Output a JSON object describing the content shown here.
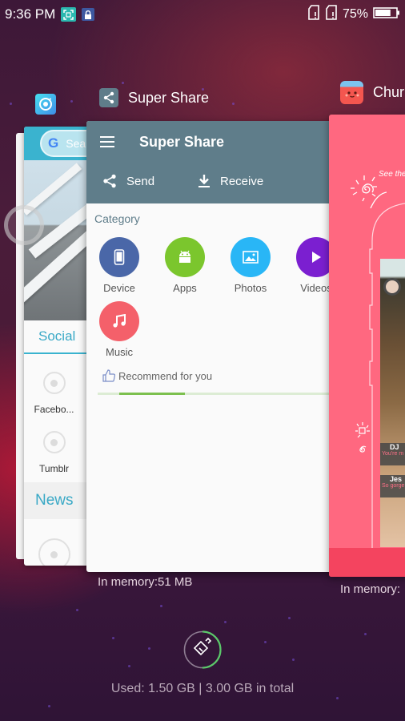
{
  "status_bar": {
    "time": "9:36 PM",
    "left_icons": [
      "screenshot-icon",
      "lock-icon"
    ],
    "right_icons": [
      "sim-1-no-signal-icon",
      "sim-2-no-signal-icon"
    ],
    "battery_percent": "75%",
    "battery_level": 0.75
  },
  "recent_apps": [
    {
      "name": "",
      "icon": "camera-app-icon",
      "icon_color": "#3fd0f0",
      "content": {
        "search_placeholder": "Sea",
        "tab": "Social",
        "items": [
          "Facebo...",
          "Tumblr"
        ],
        "section": "News"
      }
    },
    {
      "name": "Super Share",
      "icon": "share-icon",
      "icon_color": "#5f7d8a",
      "memory": "In memory:51 MB",
      "content": {
        "title": "Super Share",
        "actions": [
          {
            "label": "Send",
            "icon": "share-icon"
          },
          {
            "label": "Receive",
            "icon": "download-icon"
          }
        ],
        "category_label": "Category",
        "categories": [
          {
            "label": "Device",
            "icon": "phone-icon",
            "color": "#4a67a8"
          },
          {
            "label": "Apps",
            "icon": "android-icon",
            "color": "#7bc62d"
          },
          {
            "label": "Photos",
            "icon": "image-icon",
            "color": "#29b6f6"
          },
          {
            "label": "Videos",
            "icon": "play-icon",
            "color": "#7b1fd0"
          },
          {
            "label": "Music",
            "icon": "music-note-icon",
            "color": "#f4606a"
          }
        ],
        "recommend_label": "Recommend for you",
        "recommend_progress": 0.4
      }
    },
    {
      "name": "Chur",
      "icon": "chura-face-icon",
      "icon_color": "#f4564f",
      "memory": "In memory:",
      "content": {
        "doodle_text": "See the",
        "comments": [
          {
            "name": "DJ",
            "text": "You're m"
          },
          {
            "name": "Jes",
            "text": "So gorge"
          }
        ]
      }
    }
  ],
  "memory_usage": {
    "label": "Used: 1.50 GB | 3.00 GB in total",
    "used_fraction": 0.5,
    "clean_icon": "broom-icon",
    "ring_color": "#5bc86a"
  }
}
